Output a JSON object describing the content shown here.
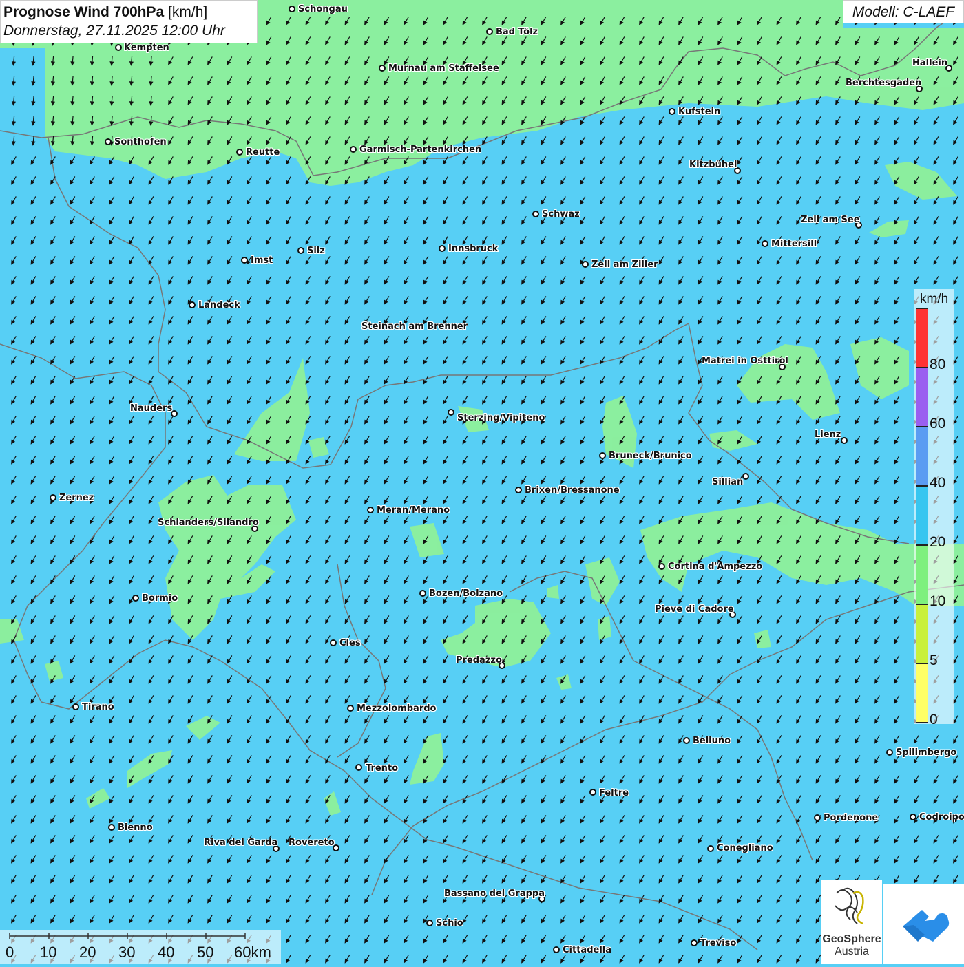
{
  "title": {
    "main_bold": "Prognose Wind 700hPa",
    "main_unit": "[km/h]",
    "datetime": "Donnerstag, 27.11.2025 12:00 Uhr"
  },
  "model_label": "Modell: C-LAEF",
  "legend": {
    "unit": "km/h",
    "levels": [
      {
        "label": "80",
        "color": "#ff3333"
      },
      {
        "label": "60",
        "color": "#9a5ff0"
      },
      {
        "label": "40",
        "color": "#5b9cf2"
      },
      {
        "label": "20",
        "color": "#37c6f0"
      },
      {
        "label": "10",
        "color": "#7ef07e"
      },
      {
        "label": "5",
        "color": "#c9f03c"
      },
      {
        "label": "0",
        "color": "#ffff66"
      }
    ]
  },
  "scale_bar": {
    "labels": [
      "0",
      "10",
      "20",
      "30",
      "40",
      "50",
      "60km"
    ]
  },
  "logo": {
    "line1": "GeoSphere",
    "line2": "Austria"
  },
  "colors": {
    "sea_blue": "#57cff5",
    "wind_green": "#8ef09a",
    "border": "#777777"
  },
  "cities": [
    {
      "name": "Schongau"
    },
    {
      "name": "Bad Tölz"
    },
    {
      "name": "Kempten"
    },
    {
      "name": "Murnau am Staffelsee"
    },
    {
      "name": "Hallein"
    },
    {
      "name": "Berchtesgaden"
    },
    {
      "name": "Kufstein"
    },
    {
      "name": "Sonthofen"
    },
    {
      "name": "Reutte"
    },
    {
      "name": "Garmisch-Partenkirchen"
    },
    {
      "name": "Kitzbühel"
    },
    {
      "name": "Schwaz"
    },
    {
      "name": "Zell am See"
    },
    {
      "name": "Mittersill"
    },
    {
      "name": "Silz"
    },
    {
      "name": "Innsbruck"
    },
    {
      "name": "Imst"
    },
    {
      "name": "Zell am Ziller"
    },
    {
      "name": "Landeck"
    },
    {
      "name": "Steinach am Brenner"
    },
    {
      "name": "Matrei in Osttirol"
    },
    {
      "name": "Nauders"
    },
    {
      "name": "Sterzing/Vipiteno"
    },
    {
      "name": "Lienz"
    },
    {
      "name": "Bruneck/Brunico"
    },
    {
      "name": "Sillian"
    },
    {
      "name": "Brixen/Bressanone"
    },
    {
      "name": "Zernez"
    },
    {
      "name": "Meran/Merano"
    },
    {
      "name": "Schlanders/Silandro"
    },
    {
      "name": "Cortina d'Ampezzo"
    },
    {
      "name": "Bozen/Bolzano"
    },
    {
      "name": "Bormio"
    },
    {
      "name": "Pieve di Cadore"
    },
    {
      "name": "Cles"
    },
    {
      "name": "Predazzo"
    },
    {
      "name": "Tirano"
    },
    {
      "name": "Mezzolombardo"
    },
    {
      "name": "Belluno"
    },
    {
      "name": "Spilimbergo"
    },
    {
      "name": "Trento"
    },
    {
      "name": "Feltre"
    },
    {
      "name": "Pordenone"
    },
    {
      "name": "Codroipo"
    },
    {
      "name": "Bienno"
    },
    {
      "name": "Riva del Garda"
    },
    {
      "name": "Rovereto"
    },
    {
      "name": "Conegliano"
    },
    {
      "name": "Bassano del Grappa"
    },
    {
      "name": "Schio"
    },
    {
      "name": "Treviso"
    },
    {
      "name": "Cittadella"
    }
  ]
}
